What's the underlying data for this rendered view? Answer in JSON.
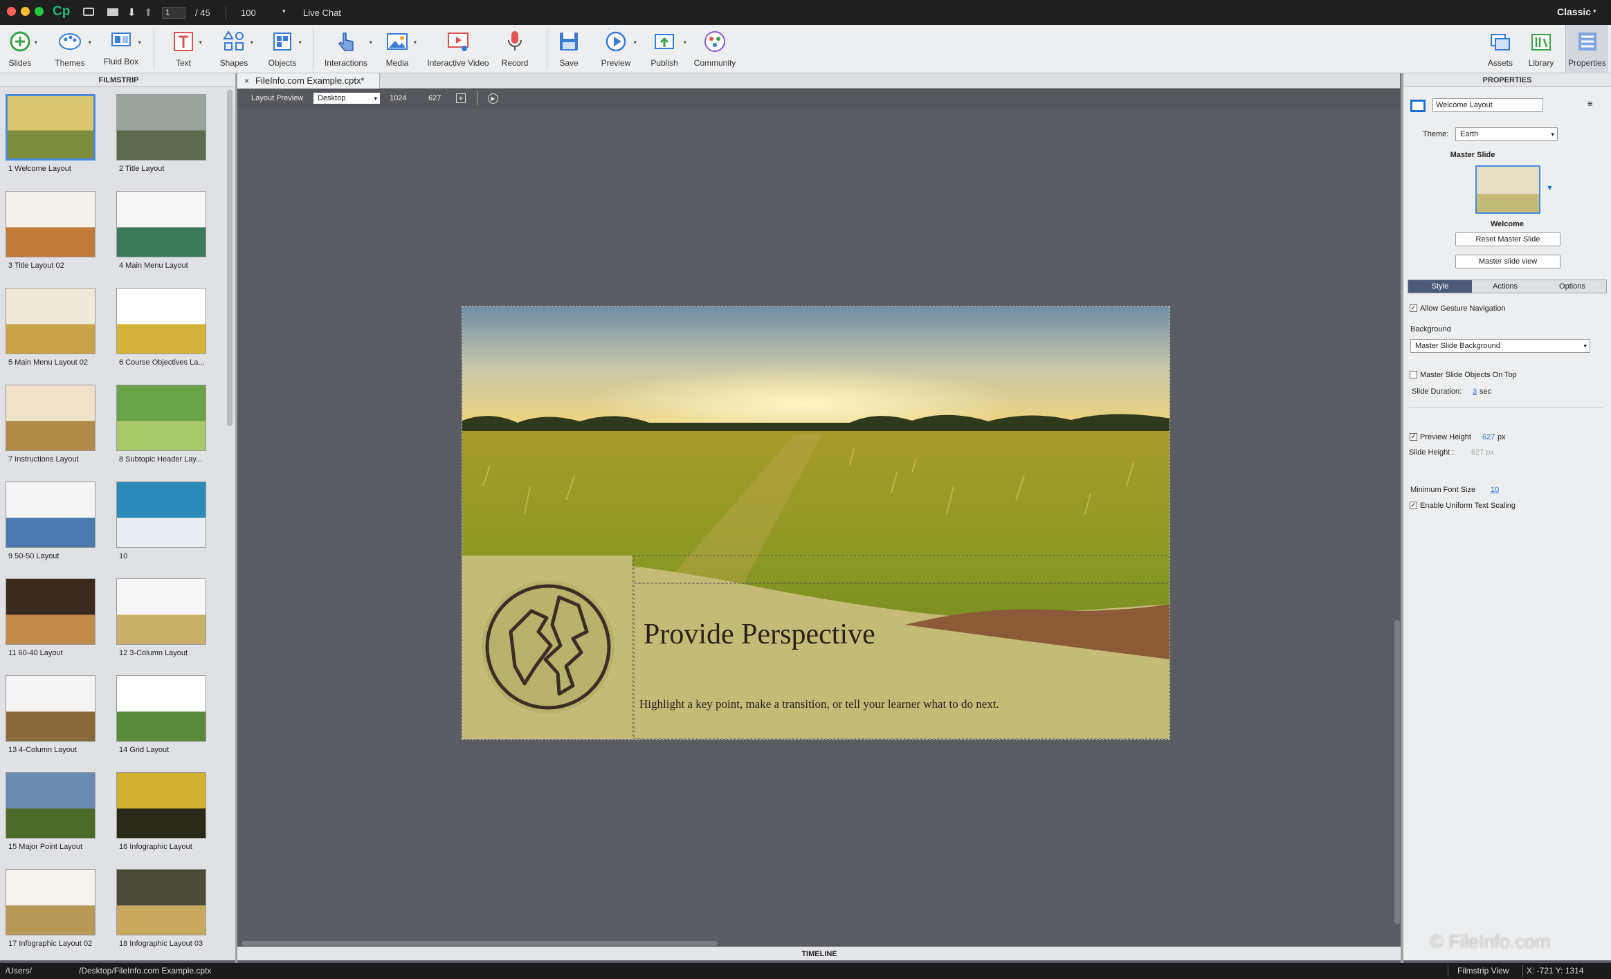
{
  "titlebar": {
    "app_logo": "Cp",
    "page_current": "1",
    "page_total": "/ 45",
    "zoom": "100",
    "live_chat": "Live Chat",
    "mode": "Classic"
  },
  "toolbar": {
    "left": [
      {
        "label": "Slides",
        "icon": "plus-circle-icon"
      },
      {
        "label": "Themes",
        "icon": "themes-icon"
      },
      {
        "label": "Fluid Box",
        "icon": "fluid-box-icon"
      },
      {
        "label": "Text",
        "icon": "text-icon"
      },
      {
        "label": "Shapes",
        "icon": "shapes-icon"
      },
      {
        "label": "Objects",
        "icon": "objects-icon"
      },
      {
        "label": "Interactions",
        "icon": "hand-pointer-icon"
      },
      {
        "label": "Media",
        "icon": "image-icon"
      },
      {
        "label": "Interactive Video",
        "icon": "video-icon"
      },
      {
        "label": "Record",
        "icon": "microphone-icon"
      },
      {
        "label": "Save",
        "icon": "save-icon"
      },
      {
        "label": "Preview",
        "icon": "play-icon"
      },
      {
        "label": "Publish",
        "icon": "publish-icon"
      },
      {
        "label": "Community",
        "icon": "community-icon"
      }
    ],
    "right": [
      {
        "label": "Assets",
        "icon": "assets-icon"
      },
      {
        "label": "Library",
        "icon": "library-icon"
      },
      {
        "label": "Properties",
        "icon": "properties-icon"
      }
    ]
  },
  "filmstrip": {
    "title": "FILMSTRIP",
    "items": [
      "1 Welcome Layout",
      "2 Title Layout",
      "3 Title Layout 02",
      "4 Main Menu Layout",
      "5 Main Menu Layout 02",
      "6 Course Objectives La...",
      "7 Instructions Layout",
      "8 Subtopic Header Lay...",
      "9 50-50 Layout",
      "10",
      "11 60-40 Layout",
      "12 3-Column Layout",
      "13 4-Column Layout",
      "14 Grid Layout",
      "15 Major Point Layout",
      "16 Infographic Layout",
      "17 Infographic Layout 02",
      "18 Infographic Layout 03"
    ]
  },
  "document_tab": {
    "close": "×",
    "title": "FileInfo.com Example.cptx*"
  },
  "layout_bar": {
    "label": "Layout Preview",
    "device": "Desktop",
    "width": "1024",
    "height": "627"
  },
  "slide": {
    "title": "Provide Perspective",
    "subtitle": "Highlight a key point, make a transition, or tell your learner what to do next."
  },
  "timeline": "TIMELINE",
  "properties": {
    "title": "PROPERTIES",
    "slide_name": "Welcome Layout",
    "theme_label": "Theme:",
    "theme_value": "Earth",
    "master_slide_label": "Master Slide",
    "master_name": "Welcome",
    "reset_btn": "Reset Master Slide",
    "master_view_btn": "Master slide view",
    "tabs": [
      "Style",
      "Actions",
      "Options"
    ],
    "allow_gesture": "Allow Gesture Navigation",
    "background_label": "Background",
    "background_value": "Master Slide Background",
    "master_objects_top": "Master Slide Objects On Top",
    "slide_duration_label": "Slide Duration:",
    "slide_duration_value": "3",
    "slide_duration_unit": "sec",
    "preview_height_label": "Preview Height",
    "preview_height_value": "627",
    "px": "px",
    "slide_height_label": "Slide Height :",
    "slide_height_value": "627 px",
    "min_font_label": "Minimum Font Size",
    "min_font_value": "10",
    "uniform_scaling": "Enable Uniform Text Scaling"
  },
  "status": {
    "path_users": "/Users/",
    "path_doc": "/Desktop/FileInfo.com Example.cptx",
    "view": "Filmstrip View",
    "coords": "X: -721 Y: 1314"
  },
  "watermark": "© FileInfo.com",
  "colors": {
    "accent": "#4a8be0",
    "slide_band": "#c3bb76",
    "earth_brown": "#8b5a38"
  }
}
